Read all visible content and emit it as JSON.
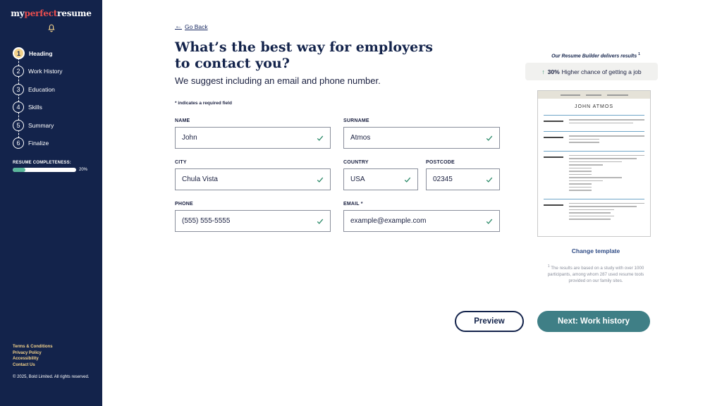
{
  "brand": {
    "prefix": "my",
    "accent": "perfect",
    "suffix": "resume"
  },
  "sidebar": {
    "steps": [
      {
        "num": "1",
        "label": "Heading"
      },
      {
        "num": "2",
        "label": "Work History"
      },
      {
        "num": "3",
        "label": "Education"
      },
      {
        "num": "4",
        "label": "Skills"
      },
      {
        "num": "5",
        "label": "Summary"
      },
      {
        "num": "6",
        "label": "Finalize"
      }
    ],
    "completeness_label": "RESUME COMPLETENESS:",
    "completeness_value": 0.2,
    "completeness_text": "20%",
    "links": [
      "Terms & Conditions",
      "Privacy Policy",
      "Accessibility",
      "Contact Us"
    ],
    "copyright": "© 2025, Bold Limited. All rights reserved."
  },
  "main": {
    "go_back": "Go Back",
    "title": "What’s the best way for employers to contact you?",
    "subtitle": "We suggest including an email and phone number.",
    "required_note": "* indicates a required field",
    "fields": {
      "name": {
        "label": "NAME",
        "value": "John"
      },
      "surname": {
        "label": "SURNAME",
        "value": "Atmos"
      },
      "city": {
        "label": "CITY",
        "value": "Chula Vista"
      },
      "country": {
        "label": "COUNTRY",
        "value": "USA"
      },
      "postcode": {
        "label": "POSTCODE",
        "value": "02345"
      },
      "phone": {
        "label": "PHONE",
        "value": "(555) 555-5555"
      },
      "email": {
        "label": "EMAIL *",
        "value": "example@example.com"
      }
    }
  },
  "panel": {
    "results_title": "Our Resume Builder delivers results",
    "results_sup": "1",
    "stat_value": "30%",
    "stat_text": "Higher chance of getting a job",
    "preview_name": "JOHN ATMOS",
    "change_template": "Change template",
    "disclaimer_sup": "1",
    "disclaimer": "The results are based on a study with over 1000 participants, among whom 287 used resume tools provided on our family sites."
  },
  "buttons": {
    "preview": "Preview",
    "next": "Next: Work history"
  },
  "colors": {
    "sidebar_bg": "#13234b",
    "accent_gold": "#f3d28a",
    "brand_red": "#e94e4e",
    "next_button": "#3f7f86",
    "check_green": "#2e8b6a"
  }
}
